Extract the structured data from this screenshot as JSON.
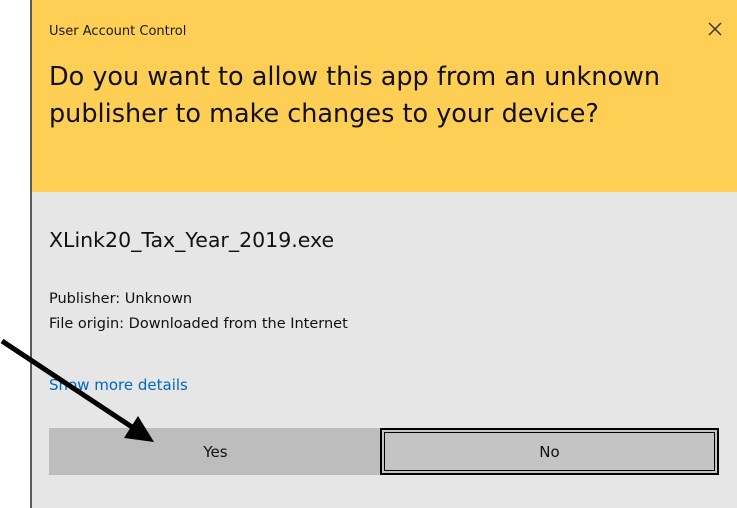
{
  "dialog": {
    "caption": "User Account Control",
    "question": "Do you want to allow this app from an unknown publisher to make changes to your device?",
    "app_name": "XLink20_Tax_Year_2019.exe",
    "publisher": "Publisher: Unknown",
    "file_origin": "File origin: Downloaded from the Internet",
    "details_link": "Show more details",
    "yes_label": "Yes",
    "no_label": "No"
  },
  "icons": {
    "close": "close-icon",
    "annotation": "arrow-annotation"
  },
  "colors": {
    "header_bg": "#ffcf55",
    "body_bg": "#e6e6e6",
    "link": "#0067c0",
    "yes_button": "#bdbdbd",
    "no_button": "#c4c4c4"
  }
}
